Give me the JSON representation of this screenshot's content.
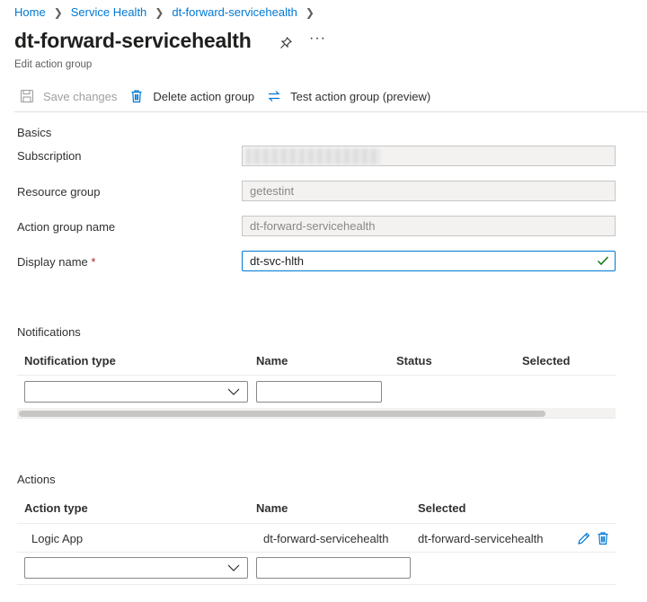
{
  "breadcrumb": {
    "items": [
      "Home",
      "Service Health",
      "dt-forward-servicehealth"
    ]
  },
  "page": {
    "title": "dt-forward-servicehealth",
    "subtitle": "Edit action group",
    "more_label": "···"
  },
  "toolbar": {
    "save_label": "Save changes",
    "delete_label": "Delete action group",
    "test_label": "Test action group (preview)"
  },
  "basics": {
    "heading": "Basics",
    "subscription_label": "Subscription",
    "subscription_value": "",
    "resource_group_label": "Resource group",
    "resource_group_value": "getestint",
    "action_group_name_label": "Action group name",
    "action_group_name_value": "dt-forward-servicehealth",
    "display_name_label": "Display name",
    "display_name_required": "*",
    "display_name_value": "dt-svc-hlth"
  },
  "notifications": {
    "heading": "Notifications",
    "columns": [
      "Notification type",
      "Name",
      "Status",
      "Selected"
    ],
    "new_row": {
      "type_value": "",
      "name_value": ""
    }
  },
  "actions": {
    "heading": "Actions",
    "columns": [
      "Action type",
      "Name",
      "Selected"
    ],
    "rows": [
      {
        "type": "Logic App",
        "name": "dt-forward-servicehealth",
        "selected": "dt-forward-servicehealth"
      }
    ],
    "new_row": {
      "type_value": "",
      "name_value": ""
    }
  },
  "colors": {
    "accent": "#0078d4",
    "text": "#323130",
    "required": "#a4262c",
    "disabled": "#a19f9d"
  },
  "icons": {
    "save": "save-icon",
    "delete": "trash-icon",
    "test": "swap-arrows-icon",
    "pin": "pin-icon",
    "check": "checkmark-icon",
    "edit": "pencil-icon",
    "chevron": "chevron-down-icon"
  }
}
